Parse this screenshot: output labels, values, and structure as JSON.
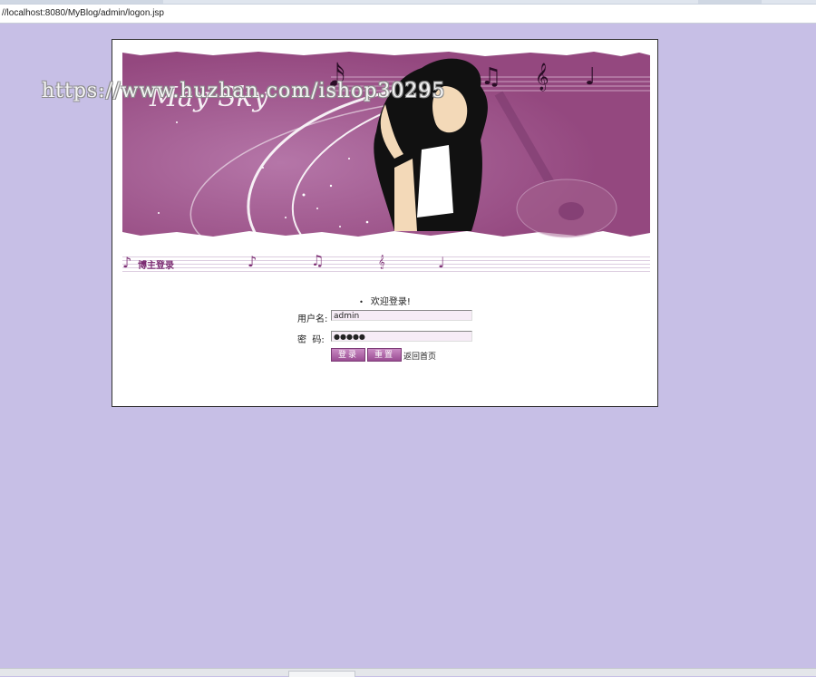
{
  "browser": {
    "url": "//localhost:8080/MyBlog/admin/logon.jsp"
  },
  "banner": {
    "logo_text": "May Sky",
    "watermark": "https://www.huzhan.com/ishop30295"
  },
  "section": {
    "title": "博主登录"
  },
  "login": {
    "welcome": "欢迎登录!",
    "username_label": "用户名:",
    "username_value": "admin",
    "password_label": "密  码:",
    "password_value": "●●●●●",
    "login_button": "登录",
    "reset_button": "重置",
    "home_link": "返回首页"
  },
  "colors": {
    "page_background": "#c7bfe6",
    "banner_purple": "#9a4f8e",
    "accent": "#7c2d73"
  }
}
